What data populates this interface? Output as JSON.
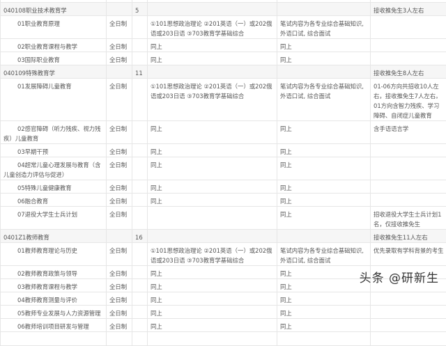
{
  "rows": [
    {
      "type": "spacer",
      "cells": [
        "",
        "",
        "",
        "",
        "",
        ""
      ]
    },
    {
      "type": "group",
      "cells": [
        "040108职业技术教育学",
        "",
        "5",
        "",
        "",
        "接收推免生3人左右"
      ]
    },
    {
      "type": "item",
      "cells": [
        "01职业教育原理",
        "全日制",
        "",
        "①101思想政治理论 ②201英语（一）或202俄语或203日语 ③703教育学基础综合",
        "笔试内容为各专业综合基础知识, 外语口试, 综合面试",
        ""
      ]
    },
    {
      "type": "item",
      "cells": [
        "02职业教育课程与教学",
        "全日制",
        "",
        "同上",
        "同上",
        ""
      ]
    },
    {
      "type": "item",
      "cells": [
        "03国际职业教育",
        "全日制",
        "",
        "同上",
        "同上",
        ""
      ]
    },
    {
      "type": "group",
      "cells": [
        "040109特殊教育学",
        "",
        "11",
        "",
        "",
        "接收推免生8人左右"
      ]
    },
    {
      "type": "item",
      "cells": [
        "01发展障碍儿童教育",
        "全日制",
        "",
        "①101思想政治理论 ②201英语（一）或202俄语或203日语 ③703教育学基础综合",
        "笔试内容为各专业综合基础知识, 外语口试, 综合面试",
        "01-06方向共招收10人左右，接收推免生7人左右。01方向含智力残疾、学习障碍、自闭症儿童教育"
      ]
    },
    {
      "type": "item",
      "cells": [
        "02感官障碍（听力残疾、视力残疾）儿童教育",
        "全日制",
        "",
        "同上",
        "同上",
        "含手语语言学"
      ]
    },
    {
      "type": "item",
      "cells": [
        "03早期干预",
        "全日制",
        "",
        "同上",
        "同上",
        ""
      ]
    },
    {
      "type": "item",
      "cells": [
        "04超常儿童心理发展与教育（含儿童创造力评估与促进）",
        "全日制",
        "",
        "同上",
        "同上",
        ""
      ]
    },
    {
      "type": "item",
      "cells": [
        "05特殊儿童健康教育",
        "全日制",
        "",
        "同上",
        "同上",
        ""
      ]
    },
    {
      "type": "item",
      "cells": [
        "06融合教育",
        "全日制",
        "",
        "同上",
        "同上",
        ""
      ]
    },
    {
      "type": "item",
      "cells": [
        "07退役大学生士兵计划",
        "全日制",
        "",
        "",
        "同上",
        "招收退役大学生士兵计划1名，仅接收推免生"
      ]
    },
    {
      "type": "group",
      "cells": [
        "0401Z1教师教育",
        "",
        "16",
        "",
        "",
        "接收推免生11人左右"
      ]
    },
    {
      "type": "item",
      "cells": [
        "01教师教育理论与历史",
        "全日制",
        "",
        "①101思想政治理论 ②201英语（一）或202俄语或203日语 ③703教育学基础综合",
        "笔试内容为各专业综合基础知识, 外语口试, 综合面试",
        "优先录取有学科背景的考生"
      ]
    },
    {
      "type": "item",
      "cells": [
        "02教师教育政策与领导",
        "全日制",
        "",
        "同上",
        "同上",
        ""
      ]
    },
    {
      "type": "item",
      "cells": [
        "03教师教育课程与教学",
        "全日制",
        "",
        "同上",
        "同上",
        ""
      ]
    },
    {
      "type": "item",
      "cells": [
        "04教师教育测量与评价",
        "全日制",
        "",
        "同上",
        "同上",
        ""
      ]
    },
    {
      "type": "item",
      "cells": [
        "05教师专业发展与人力资源管理",
        "全日制",
        "",
        "同上",
        "同上",
        ""
      ]
    },
    {
      "type": "item",
      "cells": [
        "06教师培训项目研发与管理",
        "全日制",
        "",
        "同上",
        "同上",
        ""
      ]
    },
    {
      "type": "item",
      "cells": [
        "",
        "",
        "",
        "",
        "",
        ""
      ]
    }
  ],
  "watermark": "头条 @研新生"
}
